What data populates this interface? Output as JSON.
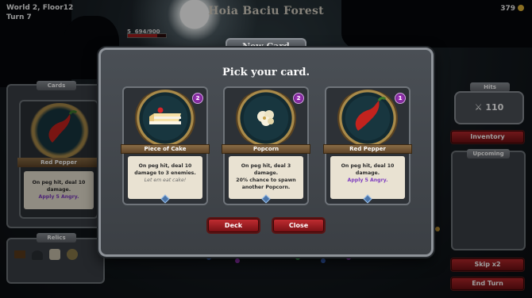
{
  "hud": {
    "world_floor": "World 2, Floor12",
    "turn": "Turn 7",
    "location": "Hoia Baciu Forest",
    "gold": "379",
    "hp_small": "5",
    "hp": "694/900",
    "hp_fraction": 0.77
  },
  "left_panel": {
    "cards_header": "Cards",
    "card_name": "Red Pepper",
    "card_desc_1": "On peg hit, deal 10 damage.",
    "card_desc_2": "Apply 5 Angry.",
    "relics_header": "Relics"
  },
  "right_panel": {
    "hits_header": "Hits",
    "hits_value": "110",
    "inventory_label": "Inventory",
    "upcoming_header": "Upcoming",
    "skip_label": "Skip x2",
    "end_turn_label": "End Turn"
  },
  "modal": {
    "tab_title": "New Card",
    "heading": "Pick your card.",
    "cards": [
      {
        "name": "Piece of Cake",
        "cost": "2",
        "icon": "cake-icon",
        "line1": "On peg hit, deal 10",
        "line2": "damage to 3 enemies.",
        "line3": "Let em eat cake!"
      },
      {
        "name": "Popcorn",
        "cost": "2",
        "icon": "popcorn-icon",
        "line1": "On peg hit, deal 3 damage.",
        "line2": "20% chance to spawn",
        "line3": "another Popcorn."
      },
      {
        "name": "Red Pepper",
        "cost": "1",
        "icon": "pepper-icon",
        "line1": "On peg hit, deal 10 damage.",
        "line2": "Apply 5 Angry.",
        "line3": ""
      }
    ],
    "deck_label": "Deck",
    "close_label": "Close"
  },
  "colors": {
    "accent_red": "#b5262b",
    "angry_purple": "#7d3bbf",
    "cost_badge": "#b23fd0"
  }
}
